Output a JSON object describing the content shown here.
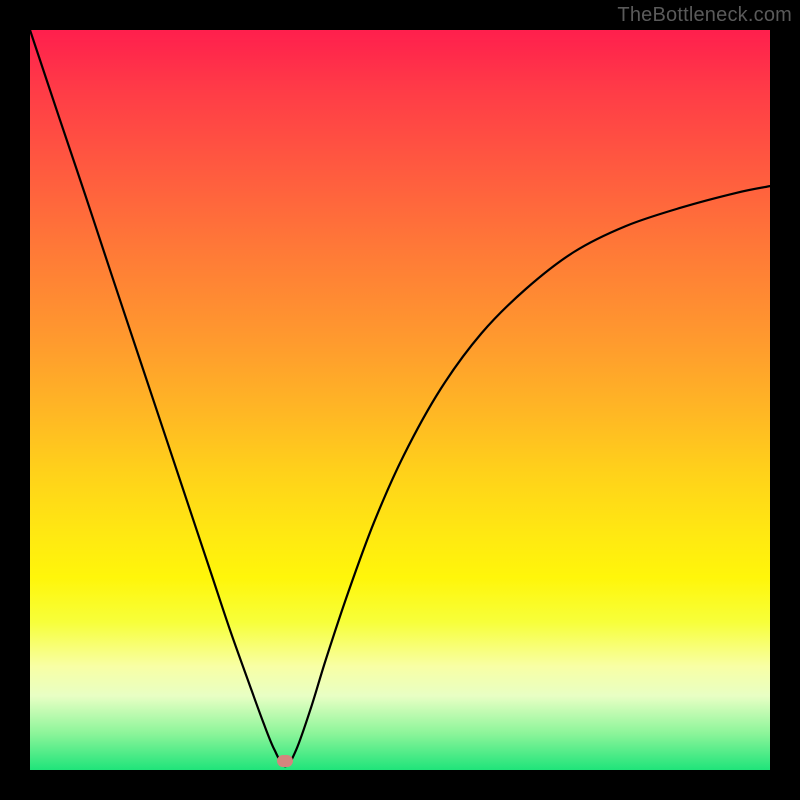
{
  "watermark": "TheBottleneck.com",
  "chart_data": {
    "type": "line",
    "title": "",
    "xlabel": "",
    "ylabel": "",
    "xlim": [
      0,
      1
    ],
    "ylim": [
      0,
      1
    ],
    "grid": false,
    "legend": false,
    "annotations": [],
    "marker": {
      "x": 0.345,
      "y": 0.012,
      "color": "#d3857e"
    },
    "series": [
      {
        "name": "bottleneck-curve",
        "color": "#000000",
        "x": [
          0.0,
          0.04,
          0.075,
          0.11,
          0.15,
          0.185,
          0.215,
          0.245,
          0.27,
          0.295,
          0.315,
          0.33,
          0.345,
          0.36,
          0.38,
          0.4,
          0.43,
          0.465,
          0.505,
          0.555,
          0.61,
          0.67,
          0.735,
          0.805,
          0.88,
          0.955,
          1.0
        ],
        "y": [
          1.0,
          0.88,
          0.776,
          0.67,
          0.55,
          0.445,
          0.355,
          0.265,
          0.19,
          0.12,
          0.065,
          0.028,
          0.005,
          0.028,
          0.085,
          0.15,
          0.24,
          0.335,
          0.425,
          0.515,
          0.59,
          0.65,
          0.7,
          0.735,
          0.76,
          0.78,
          0.789
        ]
      }
    ]
  },
  "colors": {
    "background": "#000000",
    "curve": "#000000",
    "marker": "#d3857e"
  }
}
